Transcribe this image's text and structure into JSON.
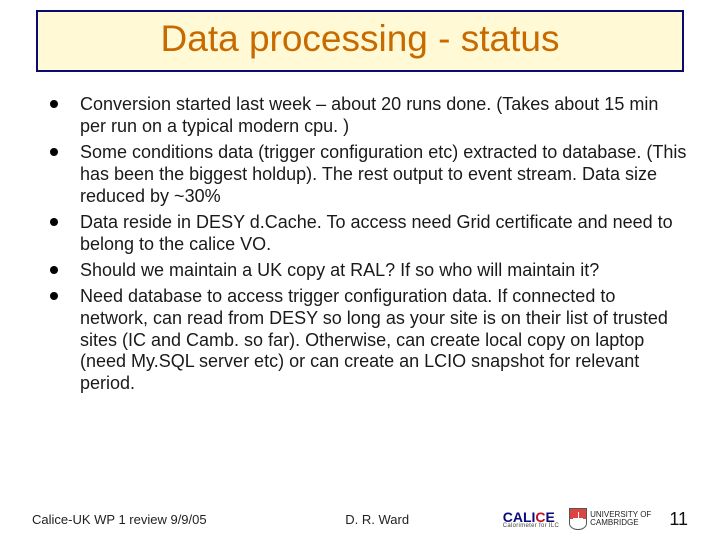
{
  "title": "Data processing - status",
  "bullets": [
    "Conversion started last week – about 20 runs done.  (Takes about 15 min per run on a typical modern cpu. )",
    "Some conditions data (trigger configuration etc) extracted to database. (This has been the biggest holdup).  The rest output to event stream.  Data size reduced by ~30%",
    "Data reside in DESY d.Cache.  To access need Grid certificate and need to belong to the calice VO.",
    "Should we maintain a UK copy at RAL?  If so who will maintain it?",
    "Need database to access trigger configuration data. If connected to network, can read from DESY so long as your site is on their list of trusted sites (IC and Camb. so far).   Otherwise, can create local copy on laptop (need My.SQL server etc) or can create an LCIO snapshot for relevant period."
  ],
  "footer": {
    "left": "Calice-UK WP 1 review  9/9/05",
    "center": "D. R. Ward",
    "page": "11"
  },
  "logos": {
    "calice": {
      "text_cal": "CAL",
      "text_i": "I",
      "text_c": "C",
      "text_e": "E",
      "sub": "Calorimeter for ILC"
    },
    "cambridge": {
      "line1": "UNIVERSITY OF",
      "line2": "CAMBRIDGE"
    }
  }
}
